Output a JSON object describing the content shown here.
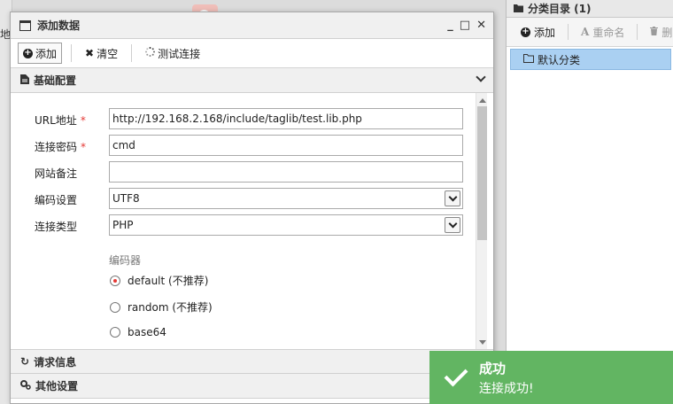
{
  "background": {
    "left_label": "地"
  },
  "category_panel": {
    "title": "分类目录 (1)",
    "toolbar": {
      "add_label": "添加",
      "rename_label": "重命名",
      "delete_label": "删"
    },
    "items": [
      {
        "label": "默认分类",
        "selected": true
      }
    ]
  },
  "dialog": {
    "title": "添加数据",
    "controls": {
      "minimize": "_",
      "maximize": "□",
      "close": "✕"
    },
    "toolbar": {
      "add_label": "添加",
      "clear_label": "清空",
      "test_label": "测试连接"
    },
    "sections": {
      "basic": "基础配置",
      "request": "请求信息",
      "other": "其他设置"
    },
    "form": {
      "url_label": "URL地址",
      "url_value": "http://192.168.2.168/include/taglib/test.lib.php",
      "password_label": "连接密码",
      "password_value": "cmd",
      "note_label": "网站备注",
      "note_value": "",
      "encoding_label": "编码设置",
      "encoding_value": "UTF8",
      "type_label": "连接类型",
      "type_value": "PHP",
      "encoder_group_label": "编码器",
      "encoders": [
        {
          "label": "default (不推荐)",
          "checked": true
        },
        {
          "label": "random (不推荐)",
          "checked": false
        },
        {
          "label": "base64",
          "checked": false
        }
      ],
      "required_mark": "*"
    }
  },
  "toast": {
    "title": "成功",
    "message": "连接成功!",
    "color": "#62b562"
  }
}
